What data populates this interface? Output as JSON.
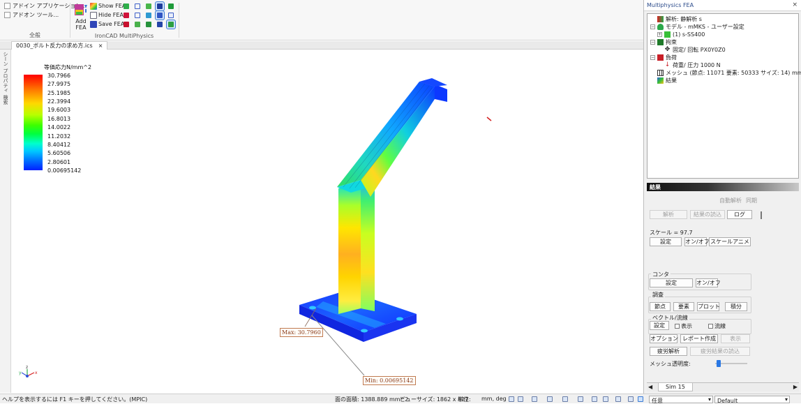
{
  "ribbon": {
    "addin_menu": [
      "アドイン アプリケーション...",
      "アドオン ツール..."
    ],
    "general_group_label": "全般",
    "add_fea_line1": "Add",
    "add_fea_line2": "FEA",
    "show_fea": "Show FEA",
    "hide_fea": "Hide FEA",
    "save_fea": "Save FEA",
    "multiphysics_group_label": "IronCAD MultiPhysics"
  },
  "document_tab": {
    "label": "0030_ボルト反力の求め方.ics",
    "close": "×"
  },
  "side_tabs": [
    "シーン",
    "プロパティ",
    "検索"
  ],
  "legend": {
    "title": "等価応力N/mm^2",
    "values": [
      "30.7966",
      "27.9975",
      "25.1985",
      "22.3994",
      "19.6003",
      "16.8013",
      "14.0022",
      "11.2032",
      "8.40412",
      "5.60506",
      "2.80601",
      "0.00695142"
    ]
  },
  "annotations": {
    "max": "Max: 30.7960",
    "min": "Min: 0.00695142"
  },
  "triad": {
    "x": "x",
    "y": "y",
    "z": "z"
  },
  "statusbar": {
    "help": "ヘルプを表示するには F1 キーを押してください。(MPIC)",
    "area": "面の面積: 1388.889 mm^2",
    "view_size": "ビューサイズ: 1862 x 827",
    "units": "単位:",
    "units_value": "mm, deg",
    "selection_mode": "任意",
    "style": "Default"
  },
  "panel": {
    "title": "Multiphysics FEA",
    "close": "×",
    "tree": {
      "analysis": "解析: 静解析 s",
      "model": "モデル - mMKS - ユーザー設定",
      "part": "(1) s-SS400",
      "constraints": "拘束",
      "fixed": "固定/ 回転 PX0Y0Z0",
      "loads": "負荷",
      "load_item": "荷重/ 圧力 1000 N",
      "mesh": "メッシュ (節点: 11071   要素: 50333   サイズ: 14) mm",
      "results": "結果"
    },
    "results": {
      "header": "結果",
      "auto_analysis": "自動解析",
      "sync": "同期",
      "analyze": "解析",
      "read_results": "結果の読込",
      "log": "ログ",
      "scale_label": "スケール = 97.7",
      "settings": "設定",
      "on_off": "オン/オフ",
      "scale_anim": "スケールアニメ",
      "contour_group": "コンタ",
      "contour_settings": "設定",
      "contour_onoff": "オン/オフ",
      "probe_group": "調査",
      "node": "節点",
      "element": "要素",
      "plot": "プロット",
      "integrate": "積分",
      "vector_group": "ベクトル/流線",
      "vector_settings": "設定",
      "show": "表示",
      "streamline": "流線",
      "options": "オプション",
      "report": "レポート作成",
      "display": "表示",
      "fatigue": "疲労解析",
      "read_fatigue": "疲労結果の読込",
      "mesh_transparency": "メッシュ透明度:",
      "mesh_transparency_level": 0.05
    },
    "bottom_tab": "Sim 15"
  },
  "colors": {
    "panel_title": "#2a4a8a",
    "annotation": "#8a3a1a",
    "accent": "#3b7bd4"
  }
}
